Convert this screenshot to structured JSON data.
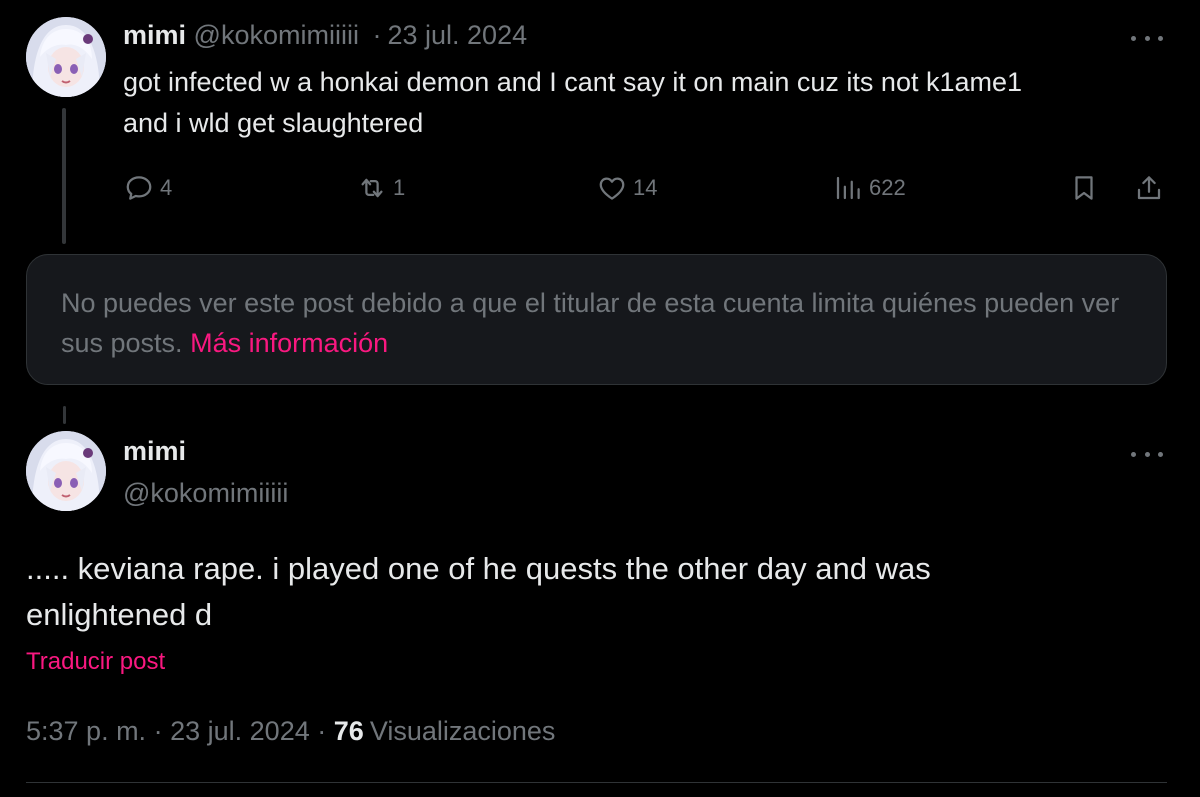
{
  "parent_tweet": {
    "display_name": "mimi",
    "handle": "@kokomimiiiii",
    "separator": "·",
    "date": "23 jul. 2024",
    "text_line1": "got infected w a honkai demon and I cant say it on main cuz its not k1ame1",
    "text_line2": "and i wld get slaughtered",
    "replies": "4",
    "reposts": "1",
    "likes": "14",
    "views": "622",
    "icons": [
      "reply-icon",
      "repost-icon",
      "like-icon",
      "views-icon",
      "bookmark-icon",
      "share-icon",
      "more-icon"
    ]
  },
  "restricted_notice": {
    "text": "No puedes ver este post debido a que el titular de esta cuenta limita quiénes pueden ver sus posts.",
    "link": "Más información"
  },
  "main_tweet": {
    "display_name": "mimi",
    "handle": "@kokomimiiiii",
    "text_line1": "..... keviana rape. i played one of he quests the other day and was",
    "text_line2": "enlightened d",
    "translate_label": "Traducir post",
    "time": "5:37 p. m.",
    "separator": "·",
    "date": "23 jul. 2024",
    "view_count": "76",
    "views_label": "Visualizaciones"
  },
  "colors": {
    "background": "#000000",
    "text": "#e7e9ea",
    "muted": "#71767b",
    "accent": "#f91880",
    "notice_bg": "#16181c",
    "border": "#2f3336"
  }
}
